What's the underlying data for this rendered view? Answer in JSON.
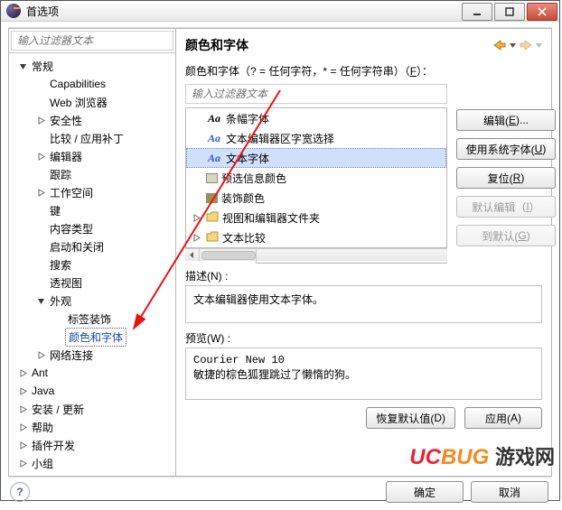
{
  "titlebar": {
    "title": "首选项"
  },
  "left": {
    "filter_placeholder": "输入过滤器文本",
    "nodes": [
      {
        "label": "常规",
        "expanded": true,
        "depth": 0
      },
      {
        "label": "Capabilities",
        "depth": 1
      },
      {
        "label": "Web 浏览器",
        "depth": 1
      },
      {
        "label": "安全性",
        "expandable": true,
        "depth": 1
      },
      {
        "label": "比较 / 应用补丁",
        "depth": 1
      },
      {
        "label": "编辑器",
        "expandable": true,
        "depth": 1
      },
      {
        "label": "跟踪",
        "depth": 1
      },
      {
        "label": "工作空间",
        "expandable": true,
        "depth": 1
      },
      {
        "label": "键",
        "depth": 1
      },
      {
        "label": "内容类型",
        "depth": 1
      },
      {
        "label": "启动和关闭",
        "depth": 1
      },
      {
        "label": "搜索",
        "depth": 1
      },
      {
        "label": "透视图",
        "depth": 1
      },
      {
        "label": "外观",
        "expanded": true,
        "depth": 1
      },
      {
        "label": "标签装饰",
        "depth": 2
      },
      {
        "label": "颜色和字体",
        "depth": 2,
        "selected": true
      },
      {
        "label": "网络连接",
        "expandable": true,
        "depth": 1
      },
      {
        "label": "Ant",
        "expandable": true,
        "depth": 0
      },
      {
        "label": "Java",
        "expandable": true,
        "depth": 0
      },
      {
        "label": "安装 / 更新",
        "expandable": true,
        "depth": 0
      },
      {
        "label": "帮助",
        "expandable": true,
        "depth": 0
      },
      {
        "label": "插件开发",
        "expandable": true,
        "depth": 0
      },
      {
        "label": "小组",
        "expandable": true,
        "depth": 0
      }
    ]
  },
  "right": {
    "heading": "颜色和字体",
    "hint_prefix": "颜色和字体（? = 任何字符，* = 任何字符串）（",
    "hint_u": "F",
    "hint_suffix": "）：",
    "filter_placeholder": "输入过滤器文本",
    "fontlist": [
      {
        "icon": "Aa",
        "label": "条幅字体"
      },
      {
        "icon": "Aa-blue",
        "label": "文本编辑器区字宽选择"
      },
      {
        "icon": "Aa-blue",
        "label": "文本字体",
        "selected": true
      },
      {
        "icon": "swatch-gray",
        "label": "预选信息颜色"
      },
      {
        "icon": "swatch-olive",
        "label": "装饰颜色"
      },
      {
        "icon": "folder",
        "label": "视图和编辑器文件夹",
        "expandable": true
      },
      {
        "icon": "folder",
        "label": "文本比较",
        "expandable": true
      }
    ],
    "buttons": {
      "edit": {
        "text": "编辑(",
        "u": "E",
        "suffix": ")..."
      },
      "system": {
        "text": "使用系统字体(",
        "u": "U",
        "suffix": ")"
      },
      "reset": {
        "text": "复位(",
        "u": "R",
        "suffix": ")"
      },
      "defedit": {
        "text": "默认编辑（",
        "u": "I",
        "suffix": "）"
      },
      "todefault": {
        "text": "到默认(",
        "u": "G",
        "suffix": ")"
      }
    },
    "desc_label_pre": "描述(",
    "desc_label_u": "N",
    "desc_label_post": ") :",
    "desc_text": "文本编辑器使用文本字体。",
    "preview_label_pre": "预览(",
    "preview_label_u": "W",
    "preview_label_post": ") :",
    "preview_text1": "Courier New 10",
    "preview_text2": "敏捷的棕色狐狸跳过了懒惰的狗。",
    "bottom": {
      "restore": {
        "text": "恢复默认值(",
        "u": "D",
        "suffix": ")"
      },
      "apply": {
        "text": "应用(",
        "u": "A",
        "suffix": ")"
      }
    }
  },
  "footer": {
    "ok": "确定",
    "cancel": "取消"
  },
  "watermark": {
    "uc": "UC",
    "bug": "BUG",
    "rest": "游戏网"
  }
}
